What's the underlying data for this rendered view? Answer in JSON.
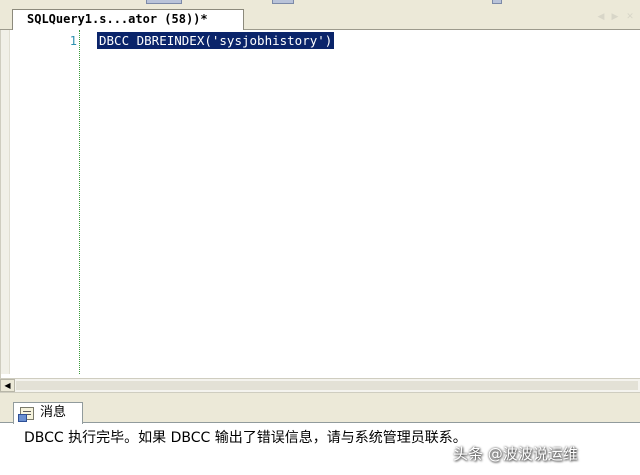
{
  "tabs": {
    "document_tab_label": "SQLQuery1.s...ator (58))*"
  },
  "editor": {
    "line_number": "1",
    "code_line": "DBCC DBREINDEX('sysjobhistory')"
  },
  "results": {
    "messages_tab_label": "消息",
    "message_text": "DBCC 执行完毕。如果 DBCC 输出了错误信息，请与系统管理员联系。"
  },
  "watermark": {
    "text": "头条 @波波说运维"
  },
  "colors": {
    "selection_background": "#0a246a",
    "line_number": "#2b91af",
    "chrome": "#ece9d8"
  },
  "icons": {
    "messages_tab": "messages-icon",
    "scroll_left": "arrow-left-icon"
  }
}
